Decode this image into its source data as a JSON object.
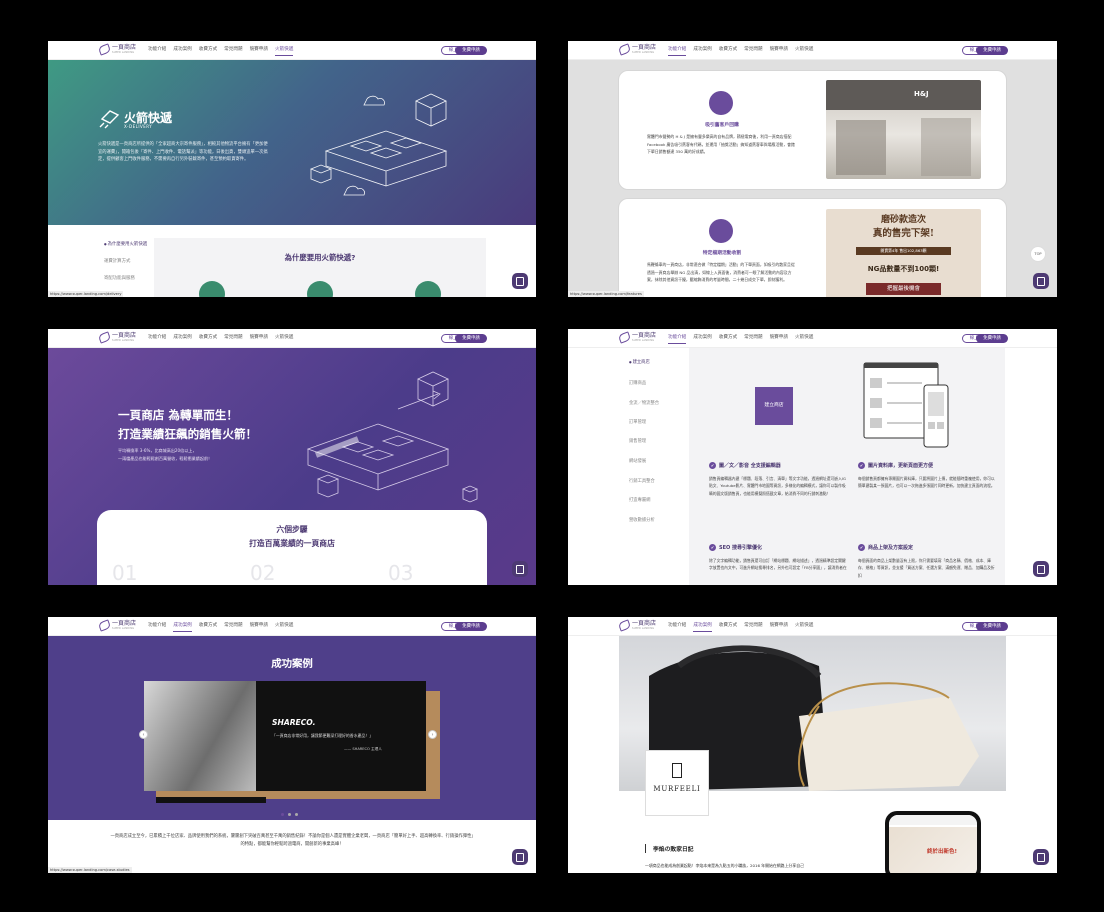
{
  "nav": {
    "logo_text": "一頁商店",
    "logo_sub": "SUPER LANDING",
    "items": [
      "功能介紹",
      "成功案例",
      "收費方式",
      "常見問題",
      "競賽申請",
      "火箭快遞"
    ],
    "login": "線上客服",
    "free": "免費申請",
    "top": "TOP"
  },
  "s1": {
    "brand": "火箭快遞",
    "brand_sub": "X-DELIVERY",
    "text": "火箭快遞是一頁商店所提供的「全家超商大宗寄件服務」，相較其他物流平台擁有「更加便宜的運費」，開箱包後「寄件、上門收件、電話幫派」等功能，日後出貨，雙頭追單一次搞定，提供顧客上門收件服務，不需要再自行另外裝載寄件，甚至預約取貨寄件。",
    "toc": [
      "為什麼要用火箭快遞",
      "運費計算方式",
      "寄配功能與服務"
    ],
    "panel_title": "為什麼要用火箭快遞?",
    "url": "https://www.super-landing.com/delivery"
  },
  "s2": {
    "card1_title": "吸引舊客戶回購",
    "card1_body": "實體門市聲勢的 H & J 是擁有豐多樂高的自有品牌，積極電商後，利用一頁商店搭配 Facebook 廣告吸引舊客有代碼，並運用「抽獎活動」搞知道舊客車與場應活動，會館下單日銷售額達 350 萬的好成績。",
    "card2_title": "特定檔期活動收割",
    "card2_body": "馬鞭條車的一頁商店，非常適合做「特定檔期」活動」的下單頁面，如吸引的散家且從透過一頁商店舉辦 NG 品出清，如線上入頁面後，消費者可一眼了解活動的內容及方案，抹除其他資訊干擾，壓縮飾消費的考量時間，二十幾日成交下單，即刻獲利。",
    "ad_line1": "磨砂款造次",
    "ad_line2": "真的售完下架!",
    "ad_line3": "開賣第4年 售出102,863顆",
    "ad_line4": "NG品數量不到100顆!",
    "ad_line5": "把握最後機會",
    "store_sign": "H&J",
    "url": "https://www.super-landing.com/features"
  },
  "s3": {
    "title1": "一頁商店 為轉單而生！",
    "title2": "打造業績狂飆的銷售火箭！",
    "body1": "平均轉換率 3-6%，比商城高出20倍以上，",
    "body2": "一兩檔產品也能輕鬆創百萬營收，輕鬆衝業績起前！",
    "card_t1": "六個步驟",
    "card_t2": "打造百萬業績的一頁商店",
    "nums": [
      "01",
      "02",
      "03"
    ]
  },
  "s4": {
    "side": [
      "建立商店",
      "訂購商品",
      "金流／物流整合",
      "訂單管理",
      "銷售管理",
      "網站發展",
      "行銷工具整合",
      "打造專屬網",
      "營收數據分析"
    ],
    "box": "建立商店",
    "f1_title": "圖／文／影音 全支援編輯器",
    "f1_body": "銷售頁編輯器內建「標題、段落、引言、清單」等文字功能，透過網址還可嵌入IG貼文、Youtube影片、實體門市地圖等資訊，多樣化的編輯模式，讓你可以製作吸睛的圖文版銷售頁，也能用模擬照搭載文章，給消費不同的行銷刺激點！",
    "f2_title": "圖片資料庫，更新頁面更方便",
    "f2_body": "每個銷售頁都擁有專屬圖片資料庫，只要將圖片上傳，就能隨時重複使用，你可以簡單建製某一張圖片，也可以一次拖進多張圖片同時更新，加快建立頁面的流程。",
    "f3_title": "SEO 搜尋引擎優化",
    "f3_body": "除了文字編輯功能，銷售頁還可自訂「網站標題、網站描述」，透過精準設定關鍵字放置也內文中，可進升網站搜尋排名，另外也可設定「FB分享圖」，讓消費者在",
    "f4_title": "商品上架及方案設定",
    "f4_body": "每個頁面的商品上架數量沒有上限，你只需要填寫「商品名稱、價格、成本、庫存、規格」等資訊，並支援「買送方案、任選方案、滿額免運、贈品、加購品及折扣"
  },
  "s5": {
    "title": "成功案例",
    "brand": "SHARECO.",
    "quote": "「一頁商店非常好用，讓我節更難深打理好的香水產品！」",
    "by": "—— SHARECO 主理人",
    "text": "一頁商店成立至今，已累積上千位店家、品牌使用我們的系統，屢屢創下突破百萬甚至千萬的銷售紀錄！不論你是個人還是實體企業老闆，一頁商店「簡單好上手、超高轉換率、行銷操作彈性」的特點，都能幫你輕鬆跨過電商，開創新的事業高峰！",
    "url": "https://www.super-landing.com/case-studies"
  },
  "s6": {
    "brand": "MURFEELI",
    "title": "李焰の敗家日記",
    "text": "一項商品也能成為創業起點！李焰本來是為九點五的小職族，2016 年開始在網路上分享自己",
    "phone_ad": "終於出新色!"
  }
}
